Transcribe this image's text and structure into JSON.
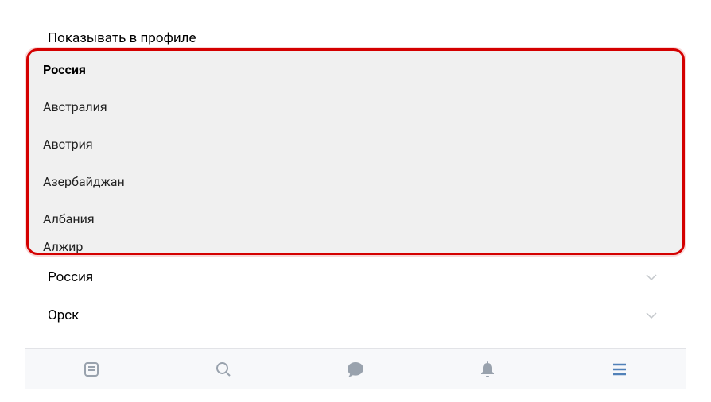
{
  "header": {
    "show_in_profile": "Показывать в профиле"
  },
  "dropdown": {
    "items": [
      {
        "label": "Россия",
        "selected": true
      },
      {
        "label": "Австралия",
        "selected": false
      },
      {
        "label": "Австрия",
        "selected": false
      },
      {
        "label": "Азербайджан",
        "selected": false
      },
      {
        "label": "Албания",
        "selected": false
      },
      {
        "label": "Алжир",
        "selected": false
      }
    ]
  },
  "selects": {
    "country": "Россия",
    "city": "Орск"
  },
  "nav": {
    "icons": [
      "news",
      "search",
      "messages",
      "notifications",
      "menu"
    ]
  },
  "colors": {
    "highlight": "#d40000",
    "accent": "#5181b8",
    "icon_inactive": "#99a2ad"
  }
}
